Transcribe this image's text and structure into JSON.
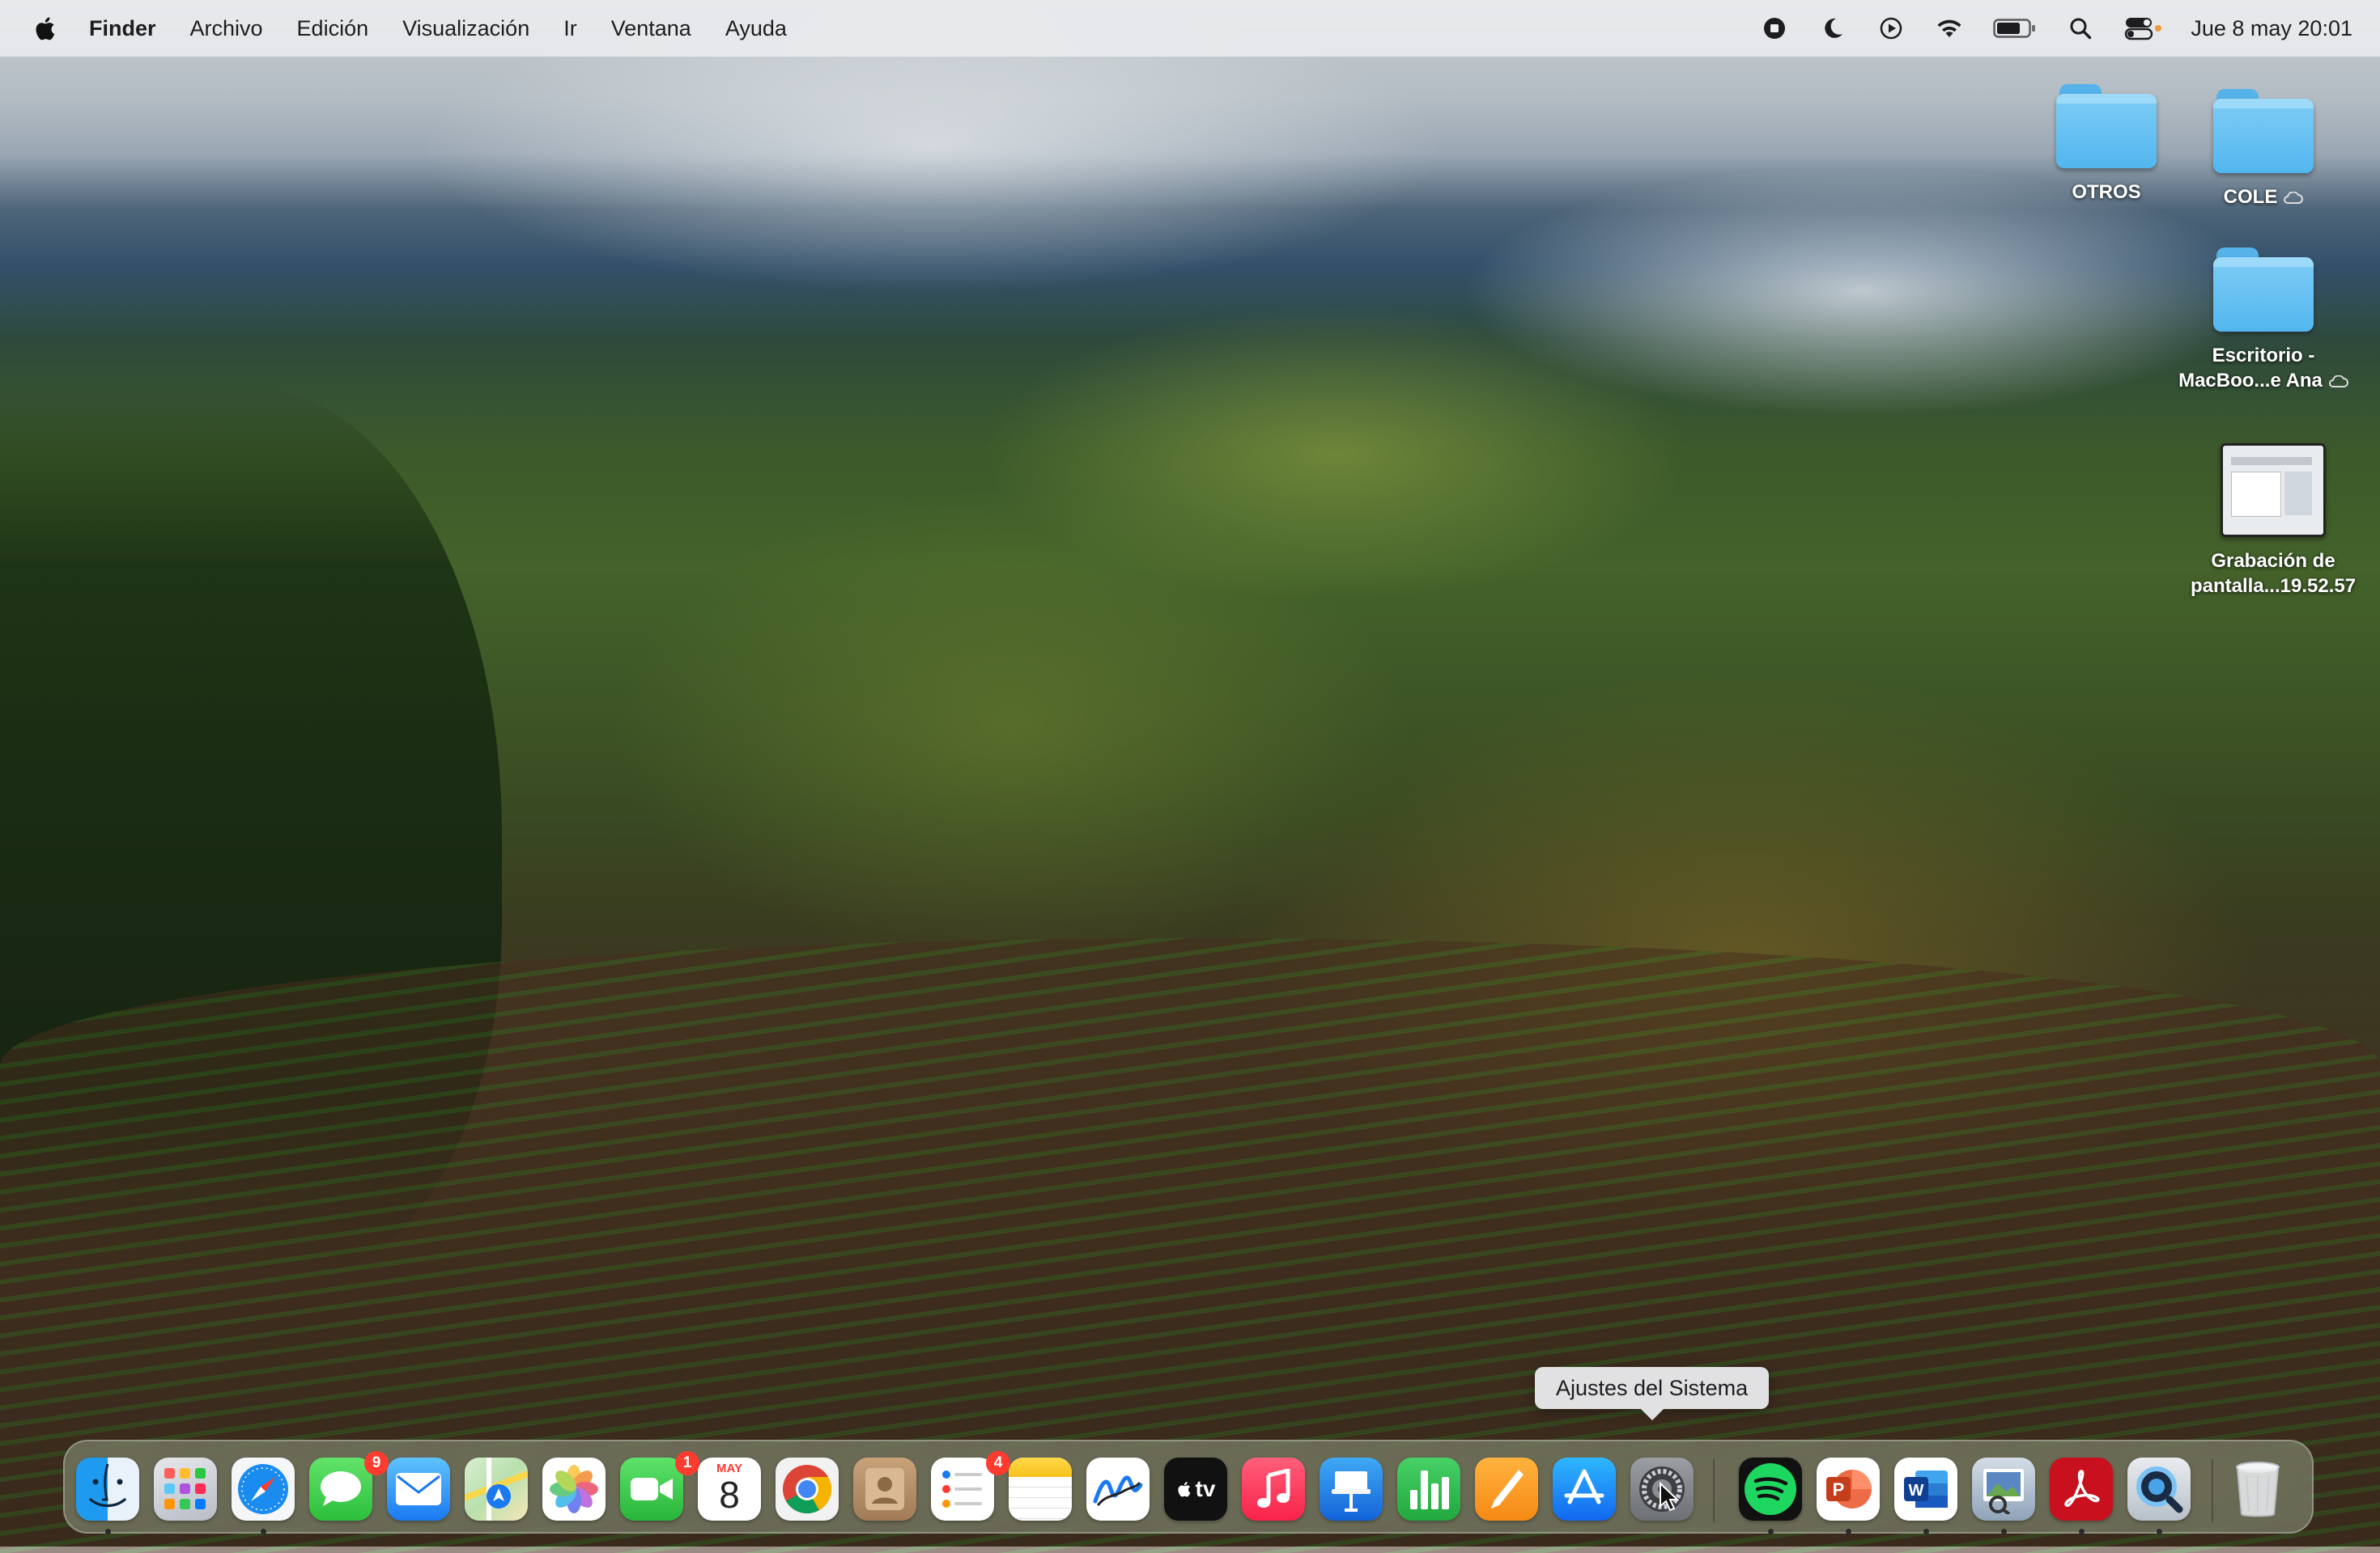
{
  "menubar": {
    "app_name": "Finder",
    "items": [
      "Archivo",
      "Edición",
      "Visualización",
      "Ir",
      "Ventana",
      "Ayuda"
    ],
    "status_icons": [
      "screen-record-icon",
      "moon-icon",
      "play-circle-icon",
      "wifi-icon",
      "battery-icon",
      "spotlight-search-icon",
      "control-center-icon"
    ],
    "clock": "Jue 8 may 20:01"
  },
  "desktop": {
    "items": [
      {
        "label": "OTROS",
        "type": "folder"
      },
      {
        "label": "COLE",
        "type": "folder",
        "icloud": true
      },
      {
        "label_line1": "Escritorio -",
        "label_line2": "MacBoo...e Ana",
        "type": "folder",
        "icloud": true
      },
      {
        "label_line1": "Grabación de",
        "label_line2": "pantalla...19.52.57",
        "type": "video"
      }
    ]
  },
  "tooltip": {
    "text": "Ajustes del Sistema"
  },
  "dock": {
    "apps": [
      {
        "name": "Finder",
        "running": true
      },
      {
        "name": "Launchpad",
        "running": false
      },
      {
        "name": "Safari",
        "running": true
      },
      {
        "name": "Mensajes",
        "badge": "9",
        "running": false
      },
      {
        "name": "Mail",
        "running": false
      },
      {
        "name": "Mapas",
        "running": false
      },
      {
        "name": "Fotos",
        "running": false
      },
      {
        "name": "FaceTime",
        "badge": "1",
        "running": false
      },
      {
        "name": "Calendario",
        "month": "MAY",
        "day": "8",
        "running": false
      },
      {
        "name": "Google Chrome",
        "running": false
      },
      {
        "name": "Contactos",
        "running": false
      },
      {
        "name": "Recordatorios",
        "badge": "4",
        "running": false
      },
      {
        "name": "Notas",
        "running": false
      },
      {
        "name": "Freeform",
        "running": false
      },
      {
        "name": "TV",
        "label": "tv",
        "running": false
      },
      {
        "name": "Música",
        "running": false
      },
      {
        "name": "Keynote",
        "running": false
      },
      {
        "name": "Numbers",
        "running": false
      },
      {
        "name": "Pages",
        "running": false
      },
      {
        "name": "App Store",
        "running": false
      },
      {
        "name": "Ajustes del Sistema",
        "running": false
      },
      {
        "name": "Spotify",
        "running": true
      },
      {
        "name": "Microsoft PowerPoint",
        "running": true
      },
      {
        "name": "Microsoft Word",
        "running": true
      },
      {
        "name": "Vista Previa",
        "running": true
      },
      {
        "name": "Adobe Acrobat",
        "running": true
      },
      {
        "name": "QuickTime Player",
        "running": true
      },
      {
        "name": "Papelera",
        "running": false
      }
    ]
  }
}
